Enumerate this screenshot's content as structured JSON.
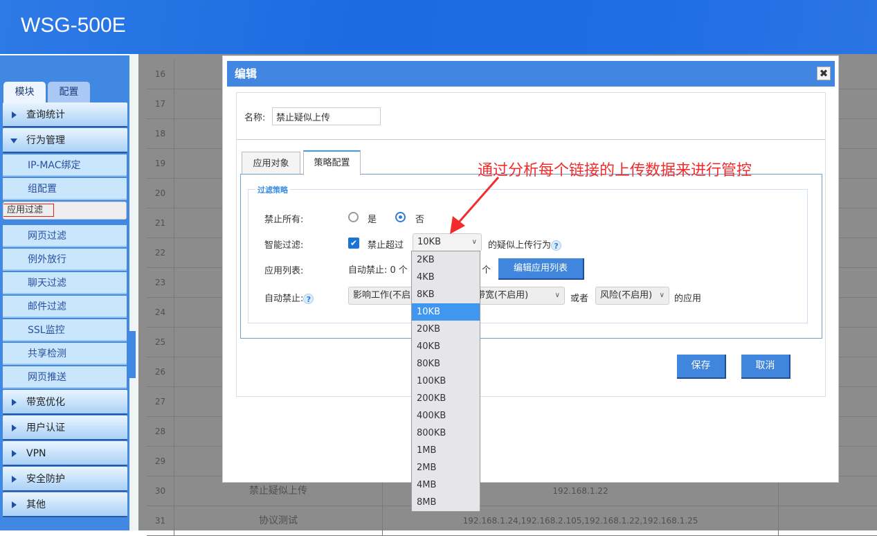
{
  "header": {
    "title": "WSG-500E"
  },
  "sidebar": {
    "tabs": [
      "模块",
      "配置"
    ],
    "groups": [
      {
        "label": "查询统计"
      },
      {
        "label": "行为管理",
        "expanded": true,
        "items": [
          "IP-MAC绑定",
          "组配置",
          "应用过滤",
          "网页过滤",
          "例外放行",
          "聊天过滤",
          "邮件过滤",
          "SSL监控",
          "共享检测",
          "网页推送"
        ],
        "selected": "应用过滤"
      },
      {
        "label": "带宽优化"
      },
      {
        "label": "用户认证"
      },
      {
        "label": "VPN"
      },
      {
        "label": "安全防护"
      },
      {
        "label": "其他"
      }
    ]
  },
  "table": {
    "rows": [
      {
        "no": "16",
        "name": "",
        "ips": ""
      },
      {
        "no": "17",
        "name": "",
        "ips": ""
      },
      {
        "no": "18",
        "name": "",
        "ips": ""
      },
      {
        "no": "19",
        "name": "",
        "ips": ""
      },
      {
        "no": "20",
        "name": "",
        "ips": ""
      },
      {
        "no": "21",
        "name": "",
        "ips": ""
      },
      {
        "no": "22",
        "name": "",
        "ips": ""
      },
      {
        "no": "23",
        "name": "",
        "ips": ""
      },
      {
        "no": "24",
        "name": "",
        "ips": ""
      },
      {
        "no": "25",
        "name": "",
        "ips": ""
      },
      {
        "no": "26",
        "name": "",
        "ips": ""
      },
      {
        "no": "27",
        "name": "",
        "ips": ""
      },
      {
        "no": "28",
        "name": "",
        "ips": ""
      },
      {
        "no": "29",
        "name": "",
        "ips": ""
      },
      {
        "no": "30",
        "name": "禁止疑似上传",
        "ips": "192.168.1.22"
      },
      {
        "no": "31",
        "name": "协议测试",
        "ips": "192.168.1.24,192.168.2.105,192.168.1.22,192.168.1.25"
      }
    ]
  },
  "modal": {
    "title": "编辑",
    "close": "✖",
    "name_label": "名称:",
    "name_value": "禁止疑似上传",
    "tabs": [
      "应用对象",
      "策略配置"
    ],
    "active_tab": "策略配置",
    "legend": "过滤策略",
    "block_all": {
      "label": "禁止所有:",
      "yes": "是",
      "no": "否",
      "selected": "否"
    },
    "smart": {
      "label": "智能过滤:",
      "checked": true,
      "prefix": "禁止超过",
      "value": "10KB",
      "suffix": "的疑似上传行为",
      "help": "?"
    },
    "applist": {
      "label": "应用列表:",
      "text": "自动禁止: 0 个",
      "count_suffix": "个",
      "button": "编辑应用列表"
    },
    "auto": {
      "label": "自动禁止:",
      "help": "?",
      "sel1": "影响工作(不启用)",
      "sel2": "占用带宽(不启用)",
      "or": "或者",
      "sel3": "风险(不启用)",
      "suffix": "的应用"
    },
    "save": "保存",
    "cancel": "取消"
  },
  "dropdown": {
    "options": [
      "2KB",
      "4KB",
      "8KB",
      "10KB",
      "20KB",
      "40KB",
      "80KB",
      "100KB",
      "200KB",
      "400KB",
      "800KB",
      "1MB",
      "2MB",
      "4MB",
      "8MB"
    ],
    "selected": "10KB"
  },
  "annotation": {
    "text": "通过分析每个链接的上传数据来进行管控",
    "color": "#f02c2c"
  }
}
